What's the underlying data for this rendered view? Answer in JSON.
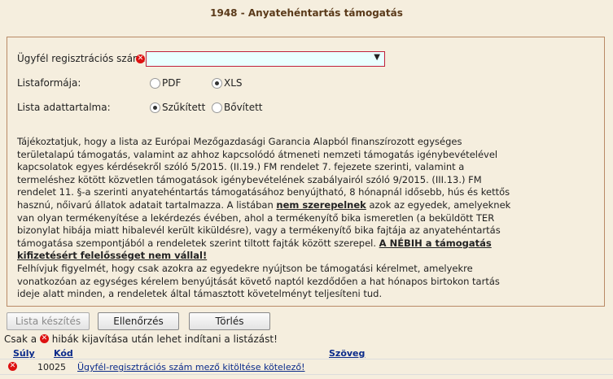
{
  "title": "1948 - Anyatehéntartás támogatás",
  "form": {
    "client_label": "Ügyfél regisztrációs szám:",
    "client_value": "",
    "listformat_label": "Listaformája:",
    "listformat_options": [
      "PDF",
      "XLS"
    ],
    "listformat_selected": "XLS",
    "listcontent_label": "Lista adattartalma:",
    "listcontent_options": [
      "Szűkített",
      "Bővített"
    ],
    "listcontent_selected": "Szűkített"
  },
  "info": {
    "p1": "Tájékoztatjuk, hogy a lista az Európai Mezőgazdasági Garancia Alapból finanszírozott egységes területalapú támogatás, valamint az ahhoz kapcsolódó átmeneti nemzeti támogatás igénybevételével kapcsolatok egyes kérdésekről szóló 5/2015. (II.19.) FM rendelet 7. fejezete szerinti, valamint a termeléshez kötött közvetlen támogatások igénybevételének szabályairól szóló 9/2015. (III.13.) FM rendelet 11. §-a szerinti anyatehéntartás támogatásához benyújtható, 8 hónapnál idősebb, hús és kettős hasznú, nőivarú állatok adatait tartalmazza. A listában ",
    "p1_bold": "nem szerepelnek",
    "p1_rest": " azok az egyedek, amelyeknek van olyan termékenyítése a lekérdezés évében, ahol a termékenyítő bika ismeretlen (a beküldött TER bizonylat hibája miatt hibalevél került kiküldésre), vagy a termékenyítő bika fajtája az anyatehéntartás támogatása szempontjából a rendeletek szerint tiltott fajták között szerepel. ",
    "p1_bold2": "A NÉBIH a támogatás kifizetésért felelősséget nem vállal!",
    "p2": "Felhívjuk figyelmét, hogy csak azokra az egyedekre nyújtson be támogatási kérelmet, amelyekre vonatkozóan az egységes kérelem benyújtását követő naptól kezdődően a hat hónapos birtokon tartás ideje alatt minden, a rendeletek által támasztott követelményt teljesíteni tud."
  },
  "buttons": {
    "create_list": "Lista készítés",
    "check": "Ellenőrzés",
    "delete": "Törlés"
  },
  "note": {
    "before": "Csak a",
    "after": "hibák kijavítása után lehet indítani a listázást!"
  },
  "errors_table": {
    "headers": {
      "severity": "Súly",
      "code": "Kód",
      "text": "Szöveg"
    },
    "rows": [
      {
        "code": "10025",
        "text": "Ügyfél-regisztrációs szám mező kitöltése kötelező!"
      }
    ]
  },
  "colors": {
    "error": "#d11111",
    "header_text": "#5a3a1a",
    "link": "#0a2a8a",
    "panel_border": "#b98a66"
  },
  "icons": {
    "error": "error-x-icon",
    "dropdown": "chevron-down-icon",
    "radio": "radio-icon"
  }
}
